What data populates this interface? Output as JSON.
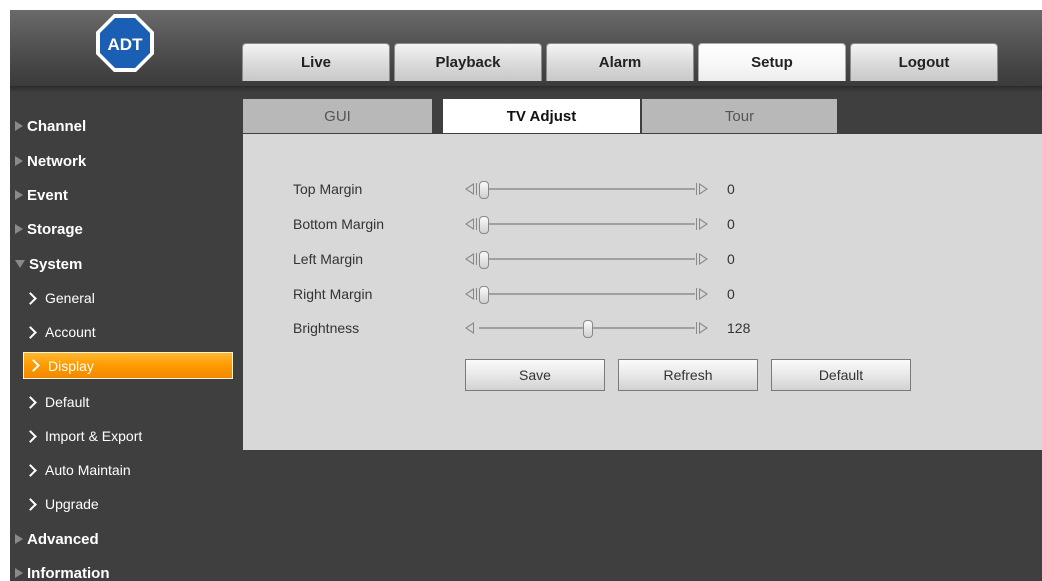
{
  "header": {
    "logo_text": "ADT",
    "tabs": [
      {
        "label": "Live"
      },
      {
        "label": "Playback"
      },
      {
        "label": "Alarm"
      },
      {
        "label": "Setup",
        "active": true
      },
      {
        "label": "Logout"
      }
    ]
  },
  "sidebar": {
    "categories": {
      "channel": "Channel",
      "network": "Network",
      "event": "Event",
      "storage": "Storage",
      "system": "System",
      "advanced": "Advanced",
      "information": "Information"
    },
    "system_items": [
      {
        "label": "General"
      },
      {
        "label": "Account"
      },
      {
        "label": "Display",
        "selected": true
      },
      {
        "label": "Default"
      },
      {
        "label": "Import & Export"
      },
      {
        "label": "Auto Maintain"
      },
      {
        "label": "Upgrade"
      }
    ]
  },
  "subtabs": [
    {
      "label": "GUI"
    },
    {
      "label": "TV Adjust",
      "active": true
    },
    {
      "label": "Tour"
    }
  ],
  "settings": [
    {
      "label": "Top Margin",
      "value": "0",
      "fraction": 0
    },
    {
      "label": "Bottom Margin",
      "value": "0",
      "fraction": 0
    },
    {
      "label": "Left Margin",
      "value": "0",
      "fraction": 0
    },
    {
      "label": "Right Margin",
      "value": "0",
      "fraction": 0
    },
    {
      "label": "Brightness",
      "value": "128",
      "fraction": 0.5
    }
  ],
  "buttons": {
    "save": "Save",
    "refresh": "Refresh",
    "default": "Default"
  },
  "colors": {
    "accent": "#ff9a00",
    "background": "#3f3f3f",
    "panel": "#d8d8d8",
    "logo_blue": "#1a5fb4"
  }
}
